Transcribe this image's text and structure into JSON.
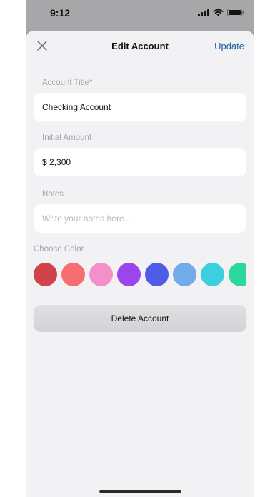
{
  "status_bar": {
    "time": "9:12"
  },
  "header": {
    "title": "Edit Account",
    "update_label": "Update"
  },
  "form": {
    "account_title": {
      "label": "Account Title*",
      "value": "Checking Account"
    },
    "initial_amount": {
      "label": "Initial Amount",
      "value": "$ 2,300"
    },
    "notes": {
      "label": "Notes",
      "placeholder": "Write your notes here..."
    }
  },
  "color_picker": {
    "label": "Choose Color",
    "colors": [
      "#d1434a",
      "#f76d72",
      "#f58fcc",
      "#9b46ec",
      "#4f5ce8",
      "#73aaeb",
      "#3ccfe0",
      "#2cd89a"
    ]
  },
  "delete_label": "Delete Account"
}
